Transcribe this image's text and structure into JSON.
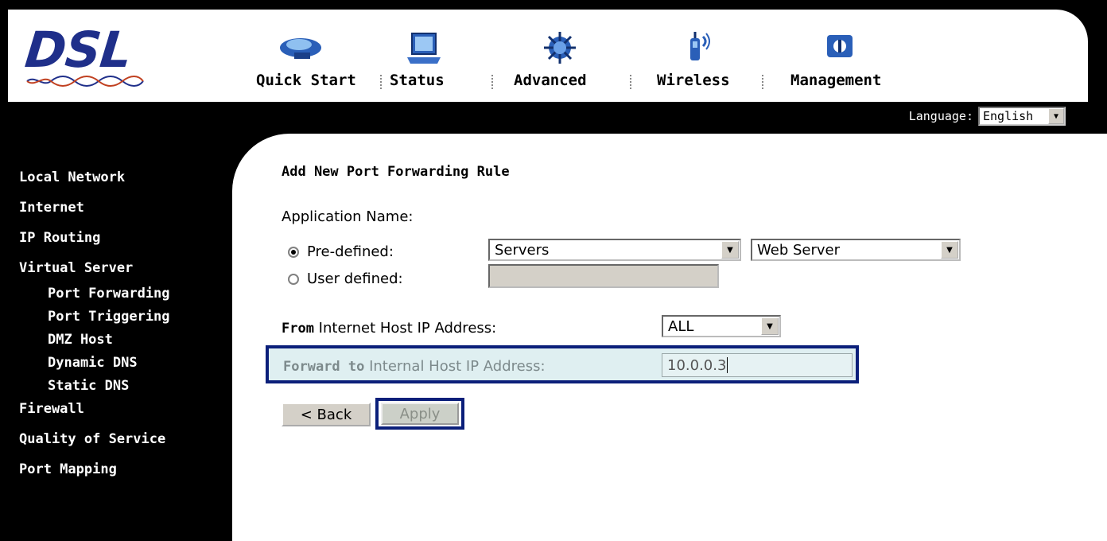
{
  "logo": {
    "text": "DSL"
  },
  "nav": {
    "items": [
      {
        "label": "Quick Start",
        "icon": "quick-start-icon"
      },
      {
        "label": "Status",
        "icon": "status-icon"
      },
      {
        "label": "Advanced",
        "icon": "advanced-icon"
      },
      {
        "label": "Wireless",
        "icon": "wireless-icon"
      },
      {
        "label": "Management",
        "icon": "management-icon"
      }
    ]
  },
  "language": {
    "label": "Language:",
    "selected": "English"
  },
  "sidebar": {
    "items": [
      {
        "label": "Local Network",
        "level": 0
      },
      {
        "label": "Internet",
        "level": 0
      },
      {
        "label": "IP Routing",
        "level": 0
      },
      {
        "label": "Virtual Server",
        "level": 0
      },
      {
        "label": "Port Forwarding",
        "level": 1
      },
      {
        "label": "Port Triggering",
        "level": 1
      },
      {
        "label": "DMZ Host",
        "level": 1
      },
      {
        "label": "Dynamic DNS",
        "level": 1
      },
      {
        "label": "Static DNS",
        "level": 1
      },
      {
        "label": "Firewall",
        "level": 0
      },
      {
        "label": "Quality of Service",
        "level": 0
      },
      {
        "label": "Port Mapping",
        "level": 0
      }
    ]
  },
  "form": {
    "title": "Add New Port Forwarding Rule",
    "app_name_label": "Application Name:",
    "predefined_label": "Pre-defined:",
    "user_defined_label": "User defined:",
    "predefined_selected": true,
    "category_select": "Servers",
    "service_select": "Web Server",
    "user_defined_value": "",
    "from_bold": "From",
    "from_rest": " Internet Host IP Address:",
    "from_select": "ALL",
    "forward_bold": "Forward to",
    "forward_rest": " Internal Host IP Address:",
    "forward_value": "10.0.0.3",
    "back_label": "< Back",
    "apply_label": "Apply"
  },
  "colors": {
    "frame": "#000000",
    "logo_blue": "#1f2f8a",
    "highlight_border": "#0b1f7a",
    "highlight_fill": "#dfeff1"
  }
}
